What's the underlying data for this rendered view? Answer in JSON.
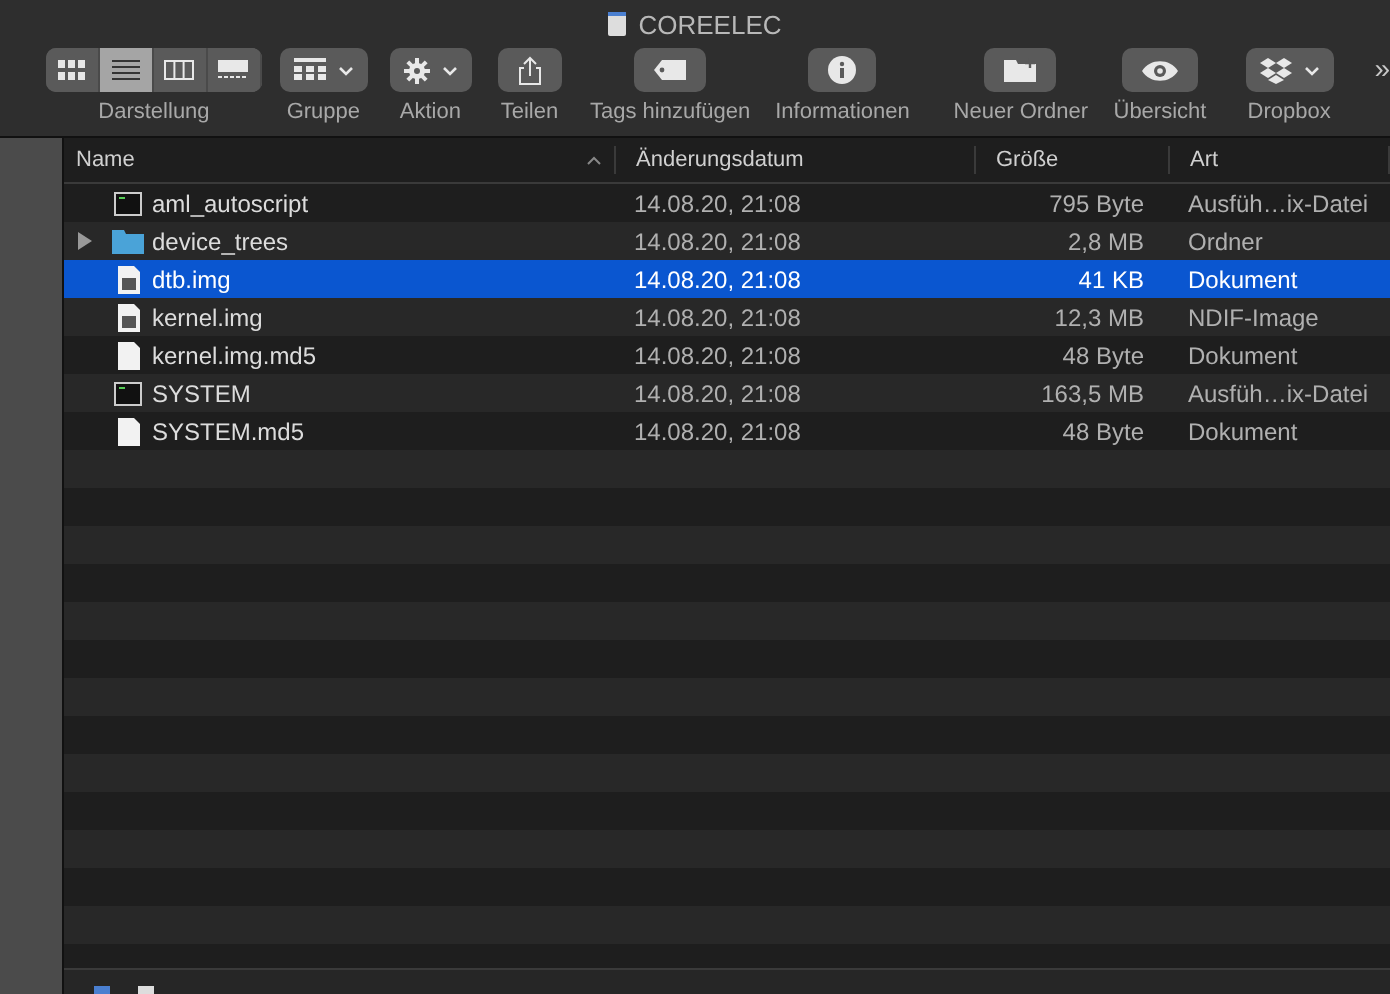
{
  "window": {
    "title": "COREELEC"
  },
  "toolbar": [
    {
      "kind": "segmented",
      "label": "Darstellung",
      "segments": [
        {
          "selected": false
        },
        {
          "selected": true
        },
        {
          "selected": false
        },
        {
          "selected": false
        }
      ]
    },
    {
      "kind": "menu",
      "label": "Gruppe"
    },
    {
      "kind": "menu",
      "label": "Aktion"
    },
    {
      "kind": "button",
      "label": "Teilen"
    },
    {
      "kind": "button",
      "label": "Tags hinzufügen"
    },
    {
      "kind": "button",
      "label": "Informationen"
    },
    {
      "kind": "button",
      "label": "Neuer Ordner"
    },
    {
      "kind": "button",
      "label": "Übersicht"
    },
    {
      "kind": "menu",
      "label": "Dropbox"
    }
  ],
  "overflow": "»",
  "table": {
    "columns": [
      {
        "label": "Name",
        "sorted": true
      },
      {
        "label": "Änderungsdatum",
        "sorted": false
      },
      {
        "label": "Größe",
        "sorted": false
      },
      {
        "label": "Art",
        "sorted": false
      }
    ],
    "rows": [
      {
        "kind": "exec",
        "name": "aml_autoscript",
        "date": "14.08.20, 21:08",
        "size": "795 Byte",
        "type": "Ausfüh…ix-Datei",
        "selected": false
      },
      {
        "kind": "folder",
        "name": "device_trees",
        "date": "14.08.20, 21:08",
        "size": "2,8 MB",
        "type": "Ordner",
        "selected": false,
        "expanded": false
      },
      {
        "kind": "image",
        "name": "dtb.img",
        "date": "14.08.20, 21:08",
        "size": "41 KB",
        "type": "Dokument",
        "selected": true
      },
      {
        "kind": "image",
        "name": "kernel.img",
        "date": "14.08.20, 21:08",
        "size": "12,3 MB",
        "type": "NDIF-Image",
        "selected": false
      },
      {
        "kind": "doc",
        "name": "kernel.img.md5",
        "date": "14.08.20, 21:08",
        "size": "48 Byte",
        "type": "Dokument",
        "selected": false
      },
      {
        "kind": "exec",
        "name": "SYSTEM",
        "date": "14.08.20, 21:08",
        "size": "163,5 MB",
        "type": "Ausfüh…ix-Datei",
        "selected": false
      },
      {
        "kind": "doc",
        "name": "SYSTEM.md5",
        "date": "14.08.20, 21:08",
        "size": "48 Byte",
        "type": "Dokument",
        "selected": false
      }
    ]
  }
}
